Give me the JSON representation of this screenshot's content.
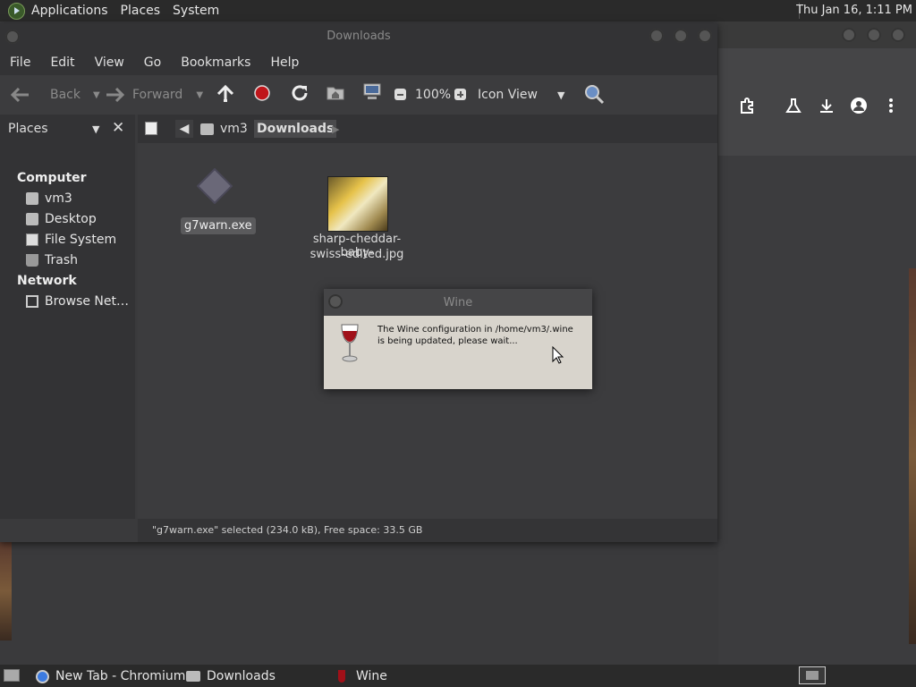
{
  "top_panel": {
    "menus": [
      "Applications",
      "Places",
      "System"
    ],
    "clock": "Thu Jan 16,  1:11 PM"
  },
  "window": {
    "title": "Downloads",
    "menubar": [
      "File",
      "Edit",
      "View",
      "Go",
      "Bookmarks",
      "Help"
    ],
    "toolbar": {
      "back": "Back",
      "forward": "Forward",
      "zoom": "100%",
      "view_mode": "Icon View"
    },
    "location": {
      "crumbs": [
        "vm3",
        "Downloads"
      ]
    },
    "sidebar": {
      "header": "Places",
      "sections": [
        {
          "title": "Computer",
          "items": [
            "vm3",
            "Desktop",
            "File System",
            "Trash"
          ]
        },
        {
          "title": "Network",
          "items": [
            "Browse Net…"
          ]
        }
      ]
    },
    "files": [
      {
        "name": "g7warn.exe",
        "icon": "exe-icon",
        "selected": true
      },
      {
        "name_line1": "sharp-cheddar-baby-",
        "name_line2": "swiss-edited.jpg",
        "icon": "image-thumbnail",
        "selected": false
      }
    ],
    "status": "\"g7warn.exe\" selected (234.0 kB), Free space: 33.5 GB"
  },
  "dialog": {
    "title": "Wine",
    "message": "The Wine configuration in /home/vm3/.wine is being updated, please wait..."
  },
  "taskbar": {
    "tasks": [
      "New Tab - Chromium",
      "Downloads",
      "Wine"
    ]
  },
  "colors": {
    "panel": "#2a2a2a",
    "window_bg": "#3c3c3e",
    "dialog_bg": "#d8d4cc",
    "stop_red": "#c0161b",
    "selection": "#5a5a5c"
  }
}
